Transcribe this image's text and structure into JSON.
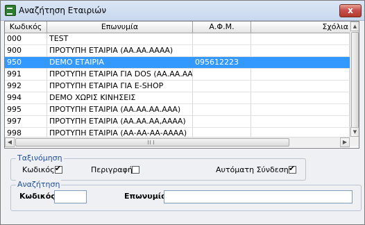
{
  "window": {
    "title": "Αναζήτηση Εταιριών",
    "close_label": "x"
  },
  "table": {
    "columns": [
      "Κωδικός",
      "Επωνυμία",
      "Α.Φ.Μ.",
      "Σχόλια"
    ],
    "rows": [
      {
        "code": "000",
        "name": "TEST",
        "afm": "",
        "notes": ""
      },
      {
        "code": "900",
        "name": "ΠΡΟΤΥΠΗ  ΕΤΑΙΡΙΑ (ΑΑ.ΑΑ.ΑΑΑΑ)",
        "afm": "",
        "notes": ""
      },
      {
        "code": "950",
        "name": "DEMO ΕΤΑΙΡΙΑ",
        "afm": "095612223",
        "notes": "",
        "selected": true
      },
      {
        "code": "991",
        "name": "ΠΡΟΤΥΠΗ ΕΤΑΙΡΙΑ ΓΙΑ DOS (ΑΑ.ΑΑ.ΑΑΑΑ)",
        "afm": "",
        "notes": ""
      },
      {
        "code": "992",
        "name": "ΠΡΟΤΥΠΗ ΕΤΑΙΡΙΑ ΓΙΑ E-SHOP",
        "afm": "",
        "notes": ""
      },
      {
        "code": "994",
        "name": "DEMO ΧΩΡΙΣ ΚΙΝΗΣΕΙΣ",
        "afm": "",
        "notes": ""
      },
      {
        "code": "995",
        "name": "ΠΡΟΤΥΠΗ ΕΤΑΙΡΙΑ (ΑΑ.ΑΑ.ΑΑ.ΑΑΑ)",
        "afm": "",
        "notes": ""
      },
      {
        "code": "997",
        "name": "ΠΡΟΤΥΠΗ ΕΤΑΙΡΙΑ (ΑΑ.ΑΑ.ΑΑ,ΑΑΑΑ)",
        "afm": "",
        "notes": ""
      },
      {
        "code": "998",
        "name": "ΠΡΟΤΥΠΗ ΕΤΑΙΡΙΑ (ΑΑ-ΑΑ-ΑΑ-ΑΑΑΑ)",
        "afm": "",
        "notes": ""
      }
    ]
  },
  "sorting": {
    "legend": "Ταξινόμηση",
    "by_code_label": "Κωδικός",
    "by_code_checked": true,
    "by_description_label": "Περιγραφή",
    "by_description_checked": false,
    "auto_connect_label": "Αυτόματη Σύνδεση",
    "auto_connect_checked": true
  },
  "search": {
    "legend": "Αναζήτηση",
    "code_label": "Κωδικός",
    "code_value": "",
    "name_label": "Επωνυμία",
    "name_value": ""
  },
  "icons": {
    "app": "app-logo-icon",
    "close": "close-icon",
    "checkmark": "✔"
  }
}
